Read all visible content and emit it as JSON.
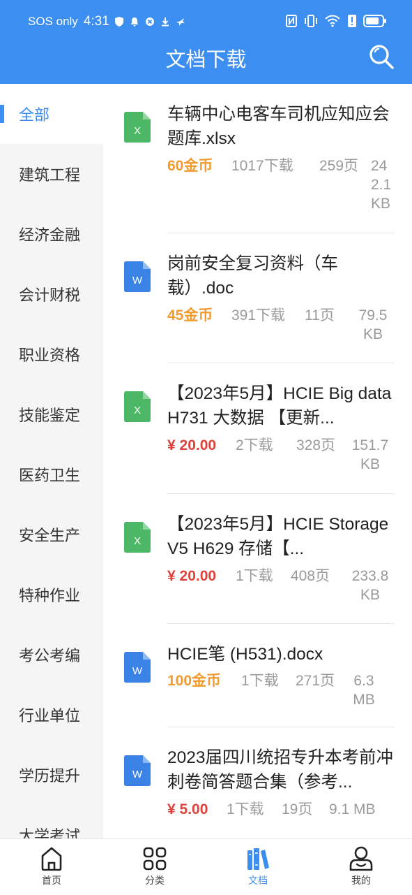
{
  "status_bar": {
    "carrier": "SOS only",
    "time": "4:31"
  },
  "header": {
    "title": "文档下载"
  },
  "colors": {
    "primary": "#3c8ef0",
    "coin_price": "#f29a2e",
    "cash_price": "#e0413a",
    "excel_icon": "#4cb866",
    "word_icon": "#3b82e6"
  },
  "sidebar": {
    "items": [
      {
        "label": "全部",
        "active": true
      },
      {
        "label": "建筑工程"
      },
      {
        "label": "经济金融"
      },
      {
        "label": "会计财税"
      },
      {
        "label": "职业资格"
      },
      {
        "label": "技能鉴定"
      },
      {
        "label": "医药卫生"
      },
      {
        "label": "安全生产"
      },
      {
        "label": "特种作业"
      },
      {
        "label": "考公考编"
      },
      {
        "label": "行业单位"
      },
      {
        "label": "学历提升"
      },
      {
        "label": "大学考试"
      }
    ]
  },
  "documents": [
    {
      "type": "xlsx",
      "icon_letter": "X",
      "name": "车辆中心电客车司机应知应会题库.xlsx",
      "price": "60金币",
      "price_kind": "coin",
      "downloads": "1017下载",
      "pages": "259页",
      "size": "242.1 KB"
    },
    {
      "type": "doc",
      "icon_letter": "W",
      "name": "岗前安全复习资料（车载）.doc",
      "price": "45金币",
      "price_kind": "coin",
      "downloads": "391下载",
      "pages": "11页",
      "size": "79.5 KB"
    },
    {
      "type": "xlsx",
      "icon_letter": "X",
      "name": "【2023年5月】HCIE Big data H731 大数据 【更新...",
      "price": "¥ 20.00",
      "price_kind": "cash",
      "downloads": "2下载",
      "pages": "328页",
      "size": "151.7 KB"
    },
    {
      "type": "xlsx",
      "icon_letter": "X",
      "name": "【2023年5月】HCIE Storage V5 H629 存储【...",
      "price": "¥ 20.00",
      "price_kind": "cash",
      "downloads": "1下载",
      "pages": "408页",
      "size": "233.8 KB"
    },
    {
      "type": "docx",
      "icon_letter": "W",
      "name": "HCIE笔 (H531).docx",
      "price": "100金币",
      "price_kind": "coin",
      "downloads": "1下载",
      "pages": "271页",
      "size": "6.3 MB"
    },
    {
      "type": "docx",
      "icon_letter": "W",
      "name": "2023届四川统招专升本考前冲刺卷简答题合集（参考...",
      "price": "¥ 5.00",
      "price_kind": "cash",
      "downloads": "1下载",
      "pages": "19页",
      "size": "9.1 MB"
    }
  ],
  "bottom_nav": {
    "items": [
      {
        "label": "首页",
        "icon": "home-icon"
      },
      {
        "label": "分类",
        "icon": "grid-icon"
      },
      {
        "label": "文档",
        "icon": "books-icon",
        "active": true
      },
      {
        "label": "我的",
        "icon": "profile-icon"
      }
    ]
  }
}
